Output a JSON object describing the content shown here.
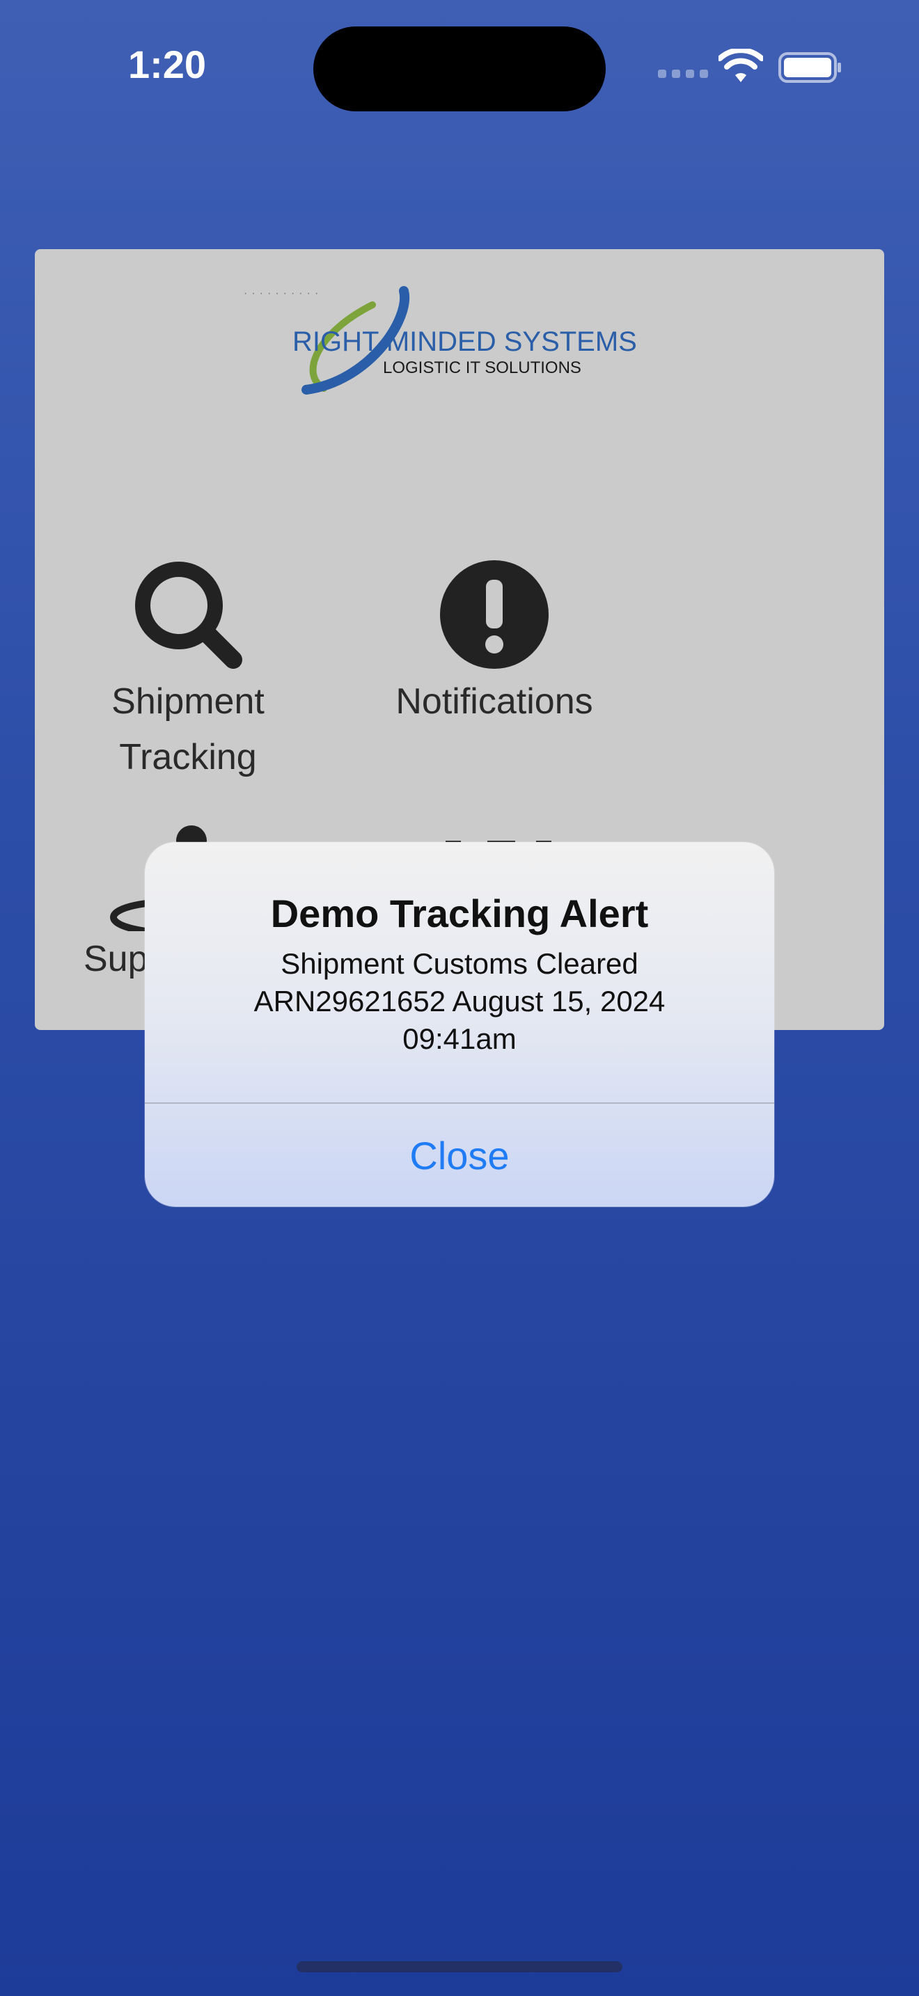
{
  "status_bar": {
    "time": "1:20"
  },
  "brand": {
    "name": "RIGHT MINDED SYSTEMS",
    "tagline": "LOGISTIC IT SOLUTIONS"
  },
  "menu": {
    "tracking_line1": "Shipment",
    "tracking_line2": "Tracking",
    "notifications": "Notifications",
    "support": "Sup"
  },
  "alert": {
    "title": "Demo Tracking Alert",
    "line1": "Shipment Customs Cleared",
    "line2": "ARN29621652 August 15, 2024",
    "line3": "09:41am",
    "close_label": "Close"
  },
  "colors": {
    "background_top": "#3f5fb5",
    "background_bottom": "#1d3b98",
    "card": "#cbcbcb",
    "link": "#1f7cf5",
    "logo_blue": "#2a5ea8",
    "logo_green": "#7ca43a"
  }
}
